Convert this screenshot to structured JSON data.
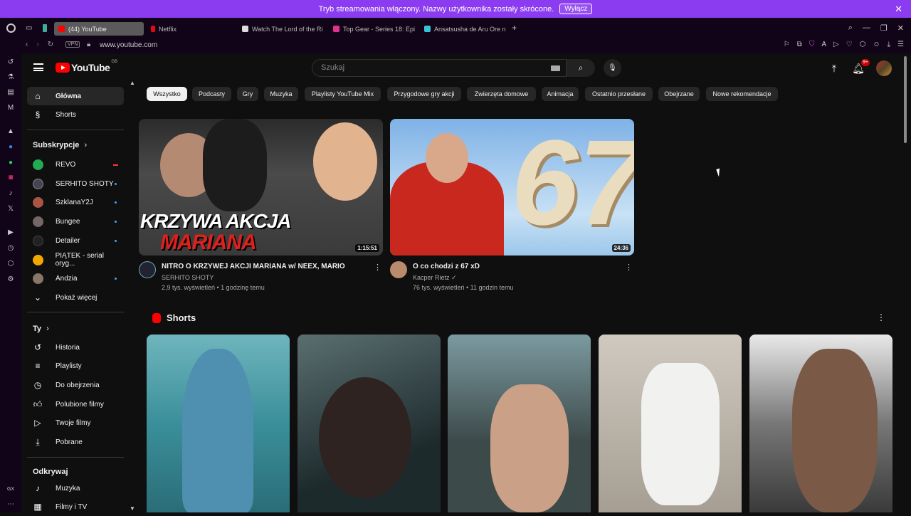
{
  "banner": {
    "text": "Tryb streamowania włączony. Nazwy użytkownika zostały skrócone.",
    "button": "Wyłącz"
  },
  "tabs": [
    {
      "label": "(44) YouTube",
      "color": "#ff0000"
    },
    {
      "label": "Netflix",
      "color": "#e50914"
    },
    {
      "label": "Watch The Lord of the Ri",
      "color": "#dddddd"
    },
    {
      "label": "Top Gear - Series 18: Epi",
      "color": "#e0338f"
    },
    {
      "label": "Ansatsusha de Aru Ore n",
      "color": "#39c3d6"
    }
  ],
  "address": {
    "vpn": "VPN",
    "url": "www.youtube.com"
  },
  "youtube": {
    "logo": "YouTube",
    "country": "GB",
    "search_placeholder": "Szukaj",
    "notifications_badge": "9+"
  },
  "sidebar": {
    "main": [
      {
        "label": "Główna",
        "icon": "home-icon"
      },
      {
        "label": "Shorts",
        "icon": "shorts-icon"
      }
    ],
    "subs_heading": "Subskrypcje",
    "subscriptions": [
      {
        "label": "REVO",
        "color": "#2a5",
        "badge": "live"
      },
      {
        "label": "SERHITO SHOTY",
        "color": "#334",
        "badge": "dot"
      },
      {
        "label": "SzklanaY2J",
        "color": "#a54",
        "badge": "dot"
      },
      {
        "label": "Bungee",
        "color": "#766",
        "badge": "dot"
      },
      {
        "label": "Detailer",
        "color": "#222",
        "badge": "dot"
      },
      {
        "label": "PIĄTEK - serial oryg...",
        "color": "#e9a",
        "badge": ""
      },
      {
        "label": "Andzia",
        "color": "#876",
        "badge": "dot"
      }
    ],
    "show_more": "Pokaż więcej",
    "you_heading": "Ty",
    "you_items": [
      {
        "label": "Historia",
        "icon": "history-icon"
      },
      {
        "label": "Playlisty",
        "icon": "playlist-icon"
      },
      {
        "label": "Do obejrzenia",
        "icon": "watch-later-icon"
      },
      {
        "label": "Polubione filmy",
        "icon": "like-icon"
      },
      {
        "label": "Twoje filmy",
        "icon": "your-videos-icon"
      },
      {
        "label": "Pobrane",
        "icon": "download-icon"
      }
    ],
    "explore_heading": "Odkrywaj",
    "explore_items": [
      {
        "label": "Muzyka",
        "icon": "music-icon"
      },
      {
        "label": "Filmy i TV",
        "icon": "movies-icon"
      }
    ]
  },
  "chips": [
    "Wszystko",
    "Podcasty",
    "Gry",
    "Muzyka",
    "Playlisty YouTube Mix",
    "Przygodowe gry akcji",
    "Zwierzęta domowe",
    "Animacja",
    "Ostatnio przesłane",
    "Obejrzane",
    "Nowe rekomendacje"
  ],
  "videos": [
    {
      "title": "NITRO O KRZYWEJ AKCJI MARIANA w/ NEEX, MARIO",
      "channel": "SERHITO SHOTY",
      "meta": "2,9 tys. wyświetleń • 1 godzinę temu",
      "duration": "1:15:51",
      "thumb_text_1": "KRZYWA AKCJA",
      "thumb_text_2": "MARIANA"
    },
    {
      "title": "O co chodzi z 67 xD",
      "channel": "Kacper Rietz",
      "meta": "76 tys. wyświetleń • 11 godzin temu",
      "duration": "24:36",
      "thumb_text_1": "67"
    }
  ],
  "shorts": {
    "heading": "Shorts"
  }
}
